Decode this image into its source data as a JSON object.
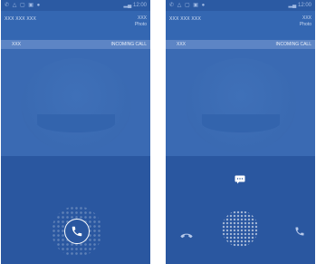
{
  "screens": [
    {
      "caller_number": "XXX XXX XXX",
      "caller_right_line1": "XXX",
      "caller_right_line2": "Photo",
      "name_label": "XXX",
      "call_status": "INCOMING CALL",
      "status_time": "12:00"
    },
    {
      "caller_number": "XXX XXX XXX",
      "caller_right_line1": "XXX",
      "caller_right_line2": "Photo",
      "name_label": "XXX",
      "call_status": "INCOMING CALL",
      "status_time": "12:00"
    }
  ],
  "icons": {
    "answer": "phone-icon",
    "reject": "hang-up-icon",
    "message": "message-icon"
  },
  "colors": {
    "background": "#2e5fa9",
    "call_bar": "#5d85c5",
    "accent": "#ffffff"
  }
}
